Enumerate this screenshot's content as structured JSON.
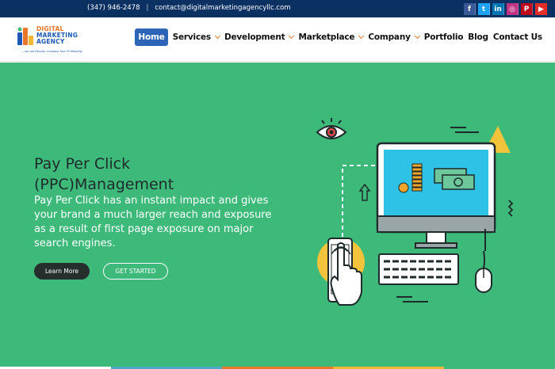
{
  "topbar": {
    "phone": "(347) 946-2478",
    "separator": "|",
    "email": "contact@digitalmarketingagencyllc.com",
    "social": [
      {
        "icon": "facebook-icon",
        "glyph": "f",
        "color": "#3b5998"
      },
      {
        "icon": "twitter-icon",
        "glyph": "t",
        "color": "#1da1f2"
      },
      {
        "icon": "linkedin-icon",
        "glyph": "in",
        "color": "#0077b5"
      },
      {
        "icon": "instagram-icon",
        "glyph": "◎",
        "color": "#c13584"
      },
      {
        "icon": "pinterest-icon",
        "glyph": "P",
        "color": "#bd081c"
      },
      {
        "icon": "youtube-icon",
        "glyph": "▶",
        "color": "#e52d27"
      }
    ]
  },
  "logo": {
    "line1": "DIGITAL",
    "line2": "MARKETING",
    "line3": "AGENCY",
    "tagline": "...we are Results. Increase Your Profitability"
  },
  "nav": {
    "items": [
      {
        "label": "Home",
        "active": true,
        "dropdown": false
      },
      {
        "label": "Services",
        "active": false,
        "dropdown": true
      },
      {
        "label": "Development",
        "active": false,
        "dropdown": true
      },
      {
        "label": "Marketplace",
        "active": false,
        "dropdown": true
      },
      {
        "label": "Company",
        "active": false,
        "dropdown": true
      },
      {
        "label": "Portfolio",
        "active": false,
        "dropdown": false
      },
      {
        "label": "Blog",
        "active": false,
        "dropdown": false
      },
      {
        "label": "Contact Us",
        "active": false,
        "dropdown": false
      }
    ]
  },
  "hero": {
    "title": "Pay Per Click (PPC)Management",
    "description": "Pay Per Click has an instant impact and gives your brand a much larger reach and exposure as a result of first page exposure on major search engines.",
    "primary_button": "Learn More",
    "secondary_button": "GET STARTED",
    "background": "#3dba7a"
  },
  "strip_colors": [
    "#ffffff",
    "#4aa8c9",
    "#e9762b",
    "#f3b634",
    "#3dba7a"
  ]
}
